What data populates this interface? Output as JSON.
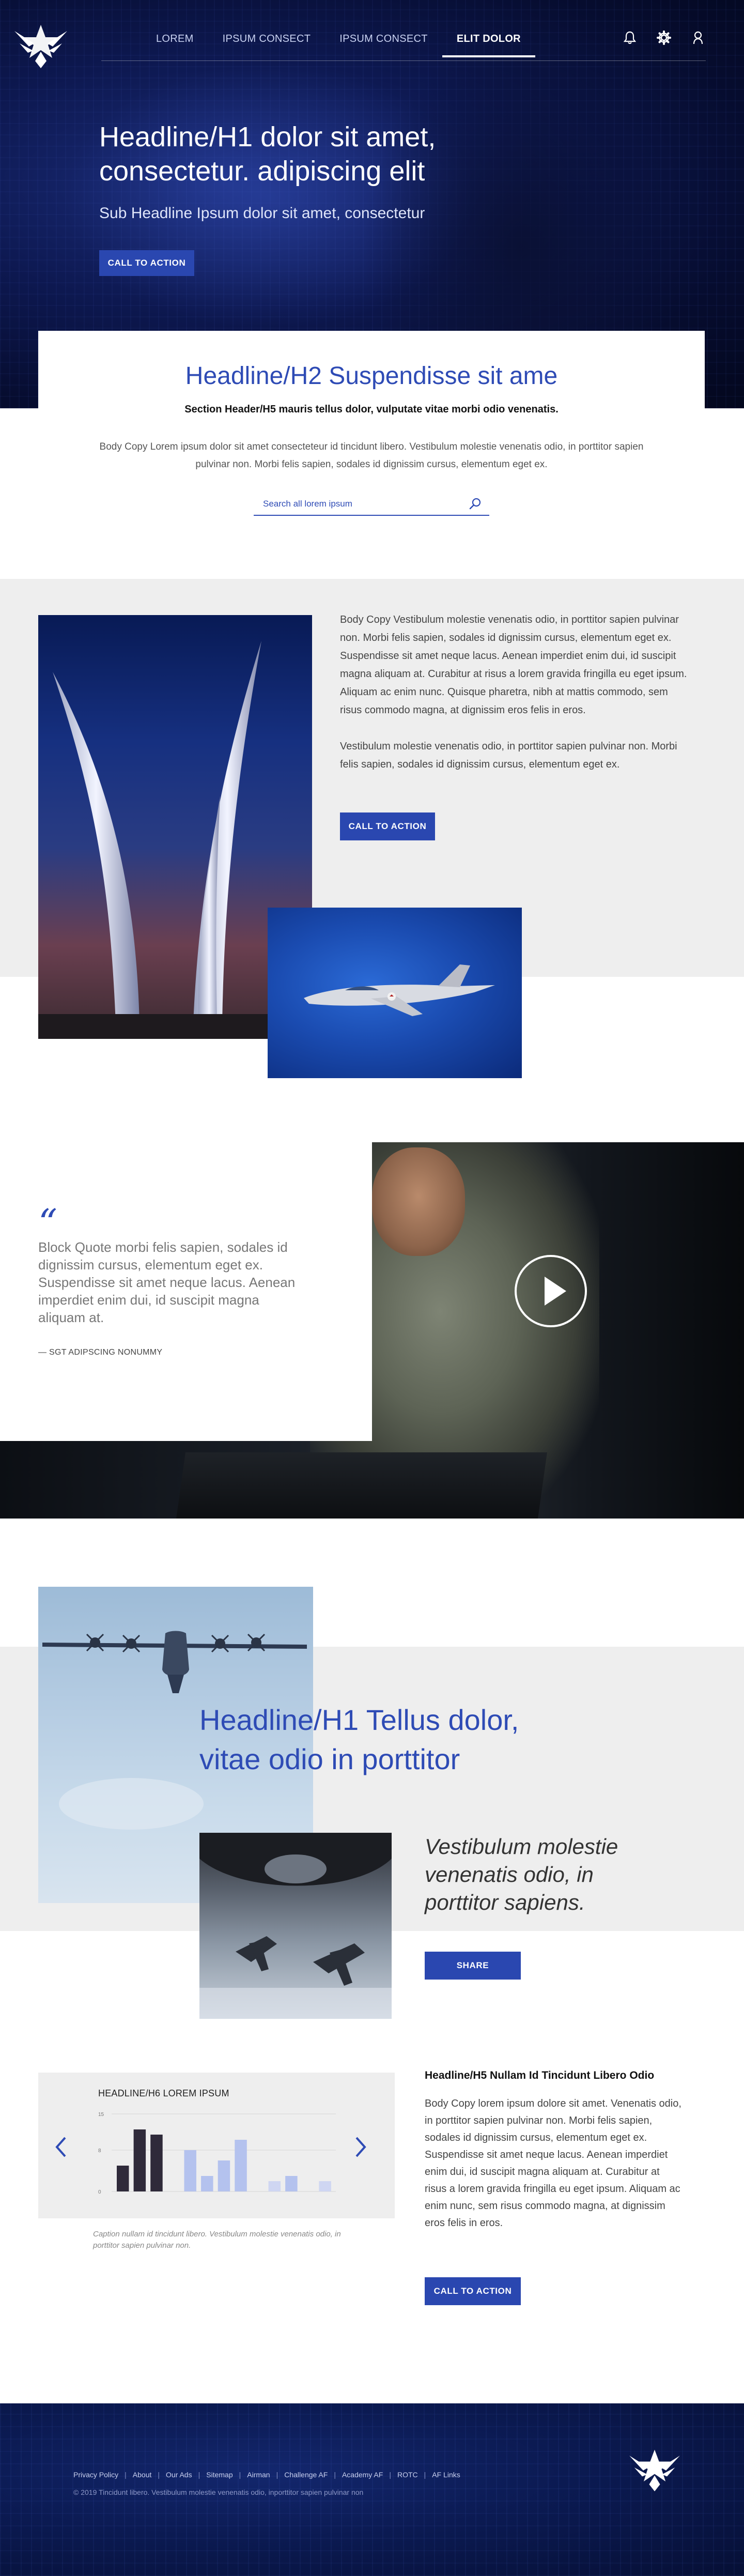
{
  "nav": {
    "links": [
      "LOREM",
      "IPSUM CONSECT",
      "IPSUM CONSECT",
      "ELIT DOLOR"
    ],
    "active_index": 3,
    "icons": [
      "bell-icon",
      "gear-icon",
      "user-icon"
    ]
  },
  "hero": {
    "headline": "Headline/H1 dolor sit amet, consectetur. adipiscing elit",
    "subheadline": "Sub Headline Ipsum dolor sit amet, consectetur",
    "cta": "CALL TO ACTION"
  },
  "intro": {
    "h2": "Headline/H2 Suspendisse sit ame",
    "h5": "Section Header/H5 mauris tellus dolor, vulputate vitae morbi odio venenatis.",
    "body": "Body Copy Lorem ipsum dolor sit amet consecteteur id tincidunt libero. Vestibulum molestie venenatis odio, in porttitor sapien pulvinar non. Morbi felis sapien, sodales id dignissim cursus, elementum eget ex.",
    "search_placeholder": "Search all lorem ipsum"
  },
  "feature": {
    "paragraph_1": "Body Copy Vestibulum molestie venenatis odio, in porttitor sapien pulvinar non. Morbi felis sapien, sodales id dignissim cursus, elementum eget ex. Suspendisse sit amet neque lacus. Aenean imperdiet enim dui, id suscipit magna aliquam at. Curabitur at risus a lorem gravida fringilla eu eget ipsum. Aliquam ac enim nunc. Quisque pharetra, nibh at mattis commodo, sem risus commodo magna, at dignissim eros felis in eros.",
    "paragraph_2": "Vestibulum molestie venenatis odio, in porttitor sapien pulvinar non. Morbi felis sapien, sodales id dignissim cursus, elementum eget ex.",
    "cta": "CALL TO ACTION"
  },
  "quote": {
    "mark": "“",
    "text": "Block Quote morbi felis sapien, sodales id dignissim cursus, elementum eget ex. Suspendisse sit amet neque lacus. Aenean imperdiet enim dui, id suscipit magna aliquam at.",
    "attribution": "— SGT ADIPSCING NONUMMY"
  },
  "story": {
    "headline": "Headline/H1 Tellus dolor, vitae odio in porttitor",
    "pull_quote": "Vestibulum molestie venenatis odio, in porttitor sapiens.",
    "share": "SHARE"
  },
  "stats": {
    "chart_title": "HEADLINE/H6  LOREM IPSUM",
    "caption": "Caption nullam id tincidunt libero. Vestibulum molestie venenatis odio, in porttitor sapien pulvinar non.",
    "h5": "Headline/H5 Nullam Id Tincidunt Libero Odio",
    "body": "Body Copy lorem ipsum dolore sit amet. Venenatis odio, in porttitor sapien pulvinar non. Morbi felis sapien, sodales id dignissim cursus, elementum eget ex. Suspendisse sit amet neque lacus. Aenean imperdiet enim dui, id suscipit magna aliquam at. Curabitur at risus a lorem gravida fringilla eu eget ipsum. Aliquam ac enim nunc, sem risus commodo magna, at dignissim eros felis in eros.",
    "cta": "CALL TO ACTION"
  },
  "chart_data": {
    "type": "bar",
    "title": "HEADLINE/H6  LOREM IPSUM",
    "xlabel": "",
    "ylabel": "",
    "ylim": [
      0,
      15
    ],
    "yticks": [
      "15",
      "8",
      "0"
    ],
    "grid": true,
    "series": [
      {
        "values": [
          5,
          11,
          12,
          9
        ],
        "color": "#2f2a3a"
      },
      {
        "values": [
          8,
          3,
          6,
          10
        ],
        "color": "#b4c2ee"
      },
      {
        "values": [
          0,
          2,
          3,
          2
        ],
        "color": "#cfd6f2"
      }
    ],
    "bars": [
      {
        "value": 5,
        "color": "#2f2a3a"
      },
      {
        "value": 12,
        "color": "#2f2a3a"
      },
      {
        "value": 11,
        "color": "#2f2a3a"
      },
      {
        "value": 0,
        "color": "#ffffff"
      },
      {
        "value": 8,
        "color": "#b4c2ee"
      },
      {
        "value": 3,
        "color": "#b4c2ee"
      },
      {
        "value": 6,
        "color": "#b4c2ee"
      },
      {
        "value": 10,
        "color": "#b4c2ee"
      },
      {
        "value": 0,
        "color": "#ffffff"
      },
      {
        "value": 2,
        "color": "#cfd6f2"
      },
      {
        "value": 3,
        "color": "#b4c2ee"
      },
      {
        "value": 0,
        "color": "#ffffff"
      },
      {
        "value": 2,
        "color": "#cfd6f2"
      }
    ]
  },
  "footer": {
    "links": [
      "Privacy Policy",
      "About",
      "Our Ads",
      "Sitemap",
      "Airman",
      "Challenge AF",
      "Academy AF",
      "ROTC",
      "AF Links"
    ],
    "copyright": "© 2019 Tincidunt libero. Vestibulum molestie venenatis odio, inporttitor sapien pulvinar non"
  },
  "colors": {
    "accent": "#2e4bb5",
    "button": "#2a47b0",
    "hero_dark": "#060c2e",
    "band_grey": "#eeeeee"
  }
}
